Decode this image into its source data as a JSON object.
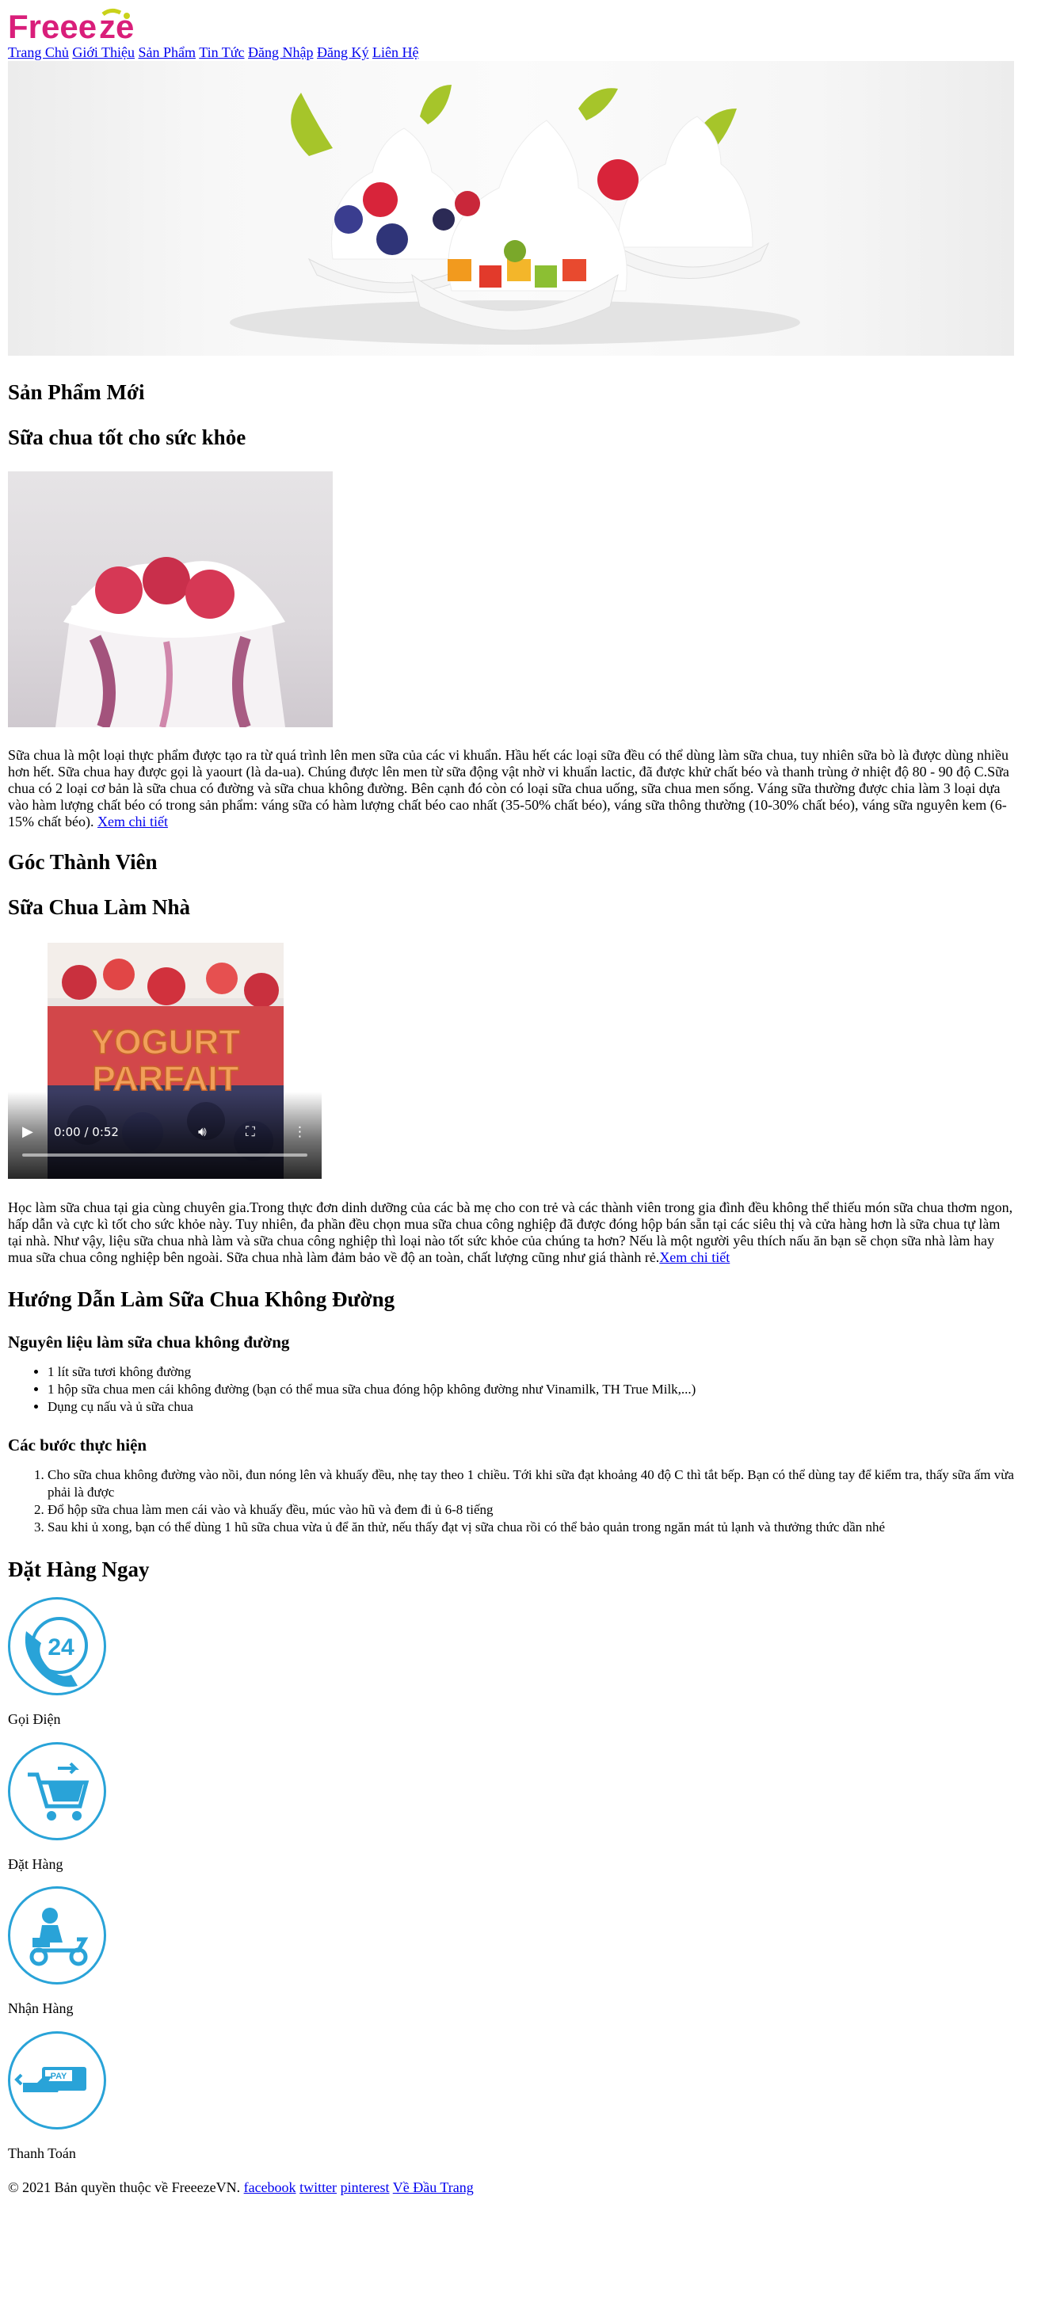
{
  "brand": {
    "logo_text": "Freeeze",
    "logo_primary_color": "#d91e7a",
    "logo_accent_color": "#c9d21a"
  },
  "nav": {
    "items": [
      {
        "label": "Trang Chủ"
      },
      {
        "label": "Giới Thiệu"
      },
      {
        "label": "Sản Phẩm"
      },
      {
        "label": "Tin Tức"
      },
      {
        "label": "Đăng Nhập"
      },
      {
        "label": "Đăng Ký"
      },
      {
        "label": "Liên Hệ"
      }
    ]
  },
  "new_products": {
    "heading": "Sản Phẩm Mới",
    "article_title": "Sữa chua tốt cho sức khỏe",
    "body": "Sữa chua là một loại thực phẩm được tạo ra từ quá trình lên men sữa của các vi khuẩn. Hầu hết các loại sữa đều có thể dùng làm sữa chua, tuy nhiên sữa bò là được dùng nhiều hơn hết. Sữa chua hay được gọi là yaourt (là da-ua). Chúng được lên men từ sữa động vật nhờ vi khuẩn lactic, đã được khử chất béo và thanh trùng ở nhiệt độ 80 - 90 độ C.Sữa chua có 2 loại cơ bản là sữa chua có đường và sữa chua không đường. Bên cạnh đó còn có loại sữa chua uống, sữa chua men sống. Váng sữa thường được chia làm 3 loại dựa vào hàm lượng chất béo có trong sản phẩm: váng sữa có hàm lượng chất béo cao nhất (35-50% chất béo), váng sữa thông thường (10-30% chất béo), váng sữa nguyên kem (6-15% chất béo). ",
    "link": "Xem chi tiết"
  },
  "members": {
    "heading": "Góc Thành Viên",
    "article_title": "Sữa Chua Làm Nhà",
    "video": {
      "overlay_line1": "YOGURT",
      "overlay_line2": "PARFAIT",
      "time": "0:00 / 0:52"
    },
    "body": "Học làm sữa chua tại gia cùng chuyên gia.Trong thực đơn dinh dưỡng của các bà mẹ cho con trẻ và các thành viên trong gia đình đều không thể thiếu món sữa chua thơm ngon, hấp dẫn và cực kì tốt cho sức khỏe này. Tuy nhiên, đa phần đều chọn mua sữa chua công nghiệp đã được đóng hộp bán sẵn tại các siêu thị và cửa hàng hơn là sữa chua tự làm tại nhà. Như vậy, liệu sữa chua nhà làm và sữa chua công nghiệp thì loại nào tốt sức khỏe của chúng ta hơn? Nếu là một người yêu thích nấu ăn bạn sẽ chọn sữa nhà làm hay mua sữa chua công nghiệp bên ngoài. Sữa chua nhà làm đảm bảo về độ an toàn, chất lượng cũng như giá thành rẻ.",
    "link": "Xem chi tiết"
  },
  "guide": {
    "heading": "Hướng Dẫn Làm Sữa Chua Không Đường",
    "ingredients_title": "Nguyên liệu làm sữa chua không đường",
    "ingredients": [
      "1 lít sữa tươi không đường",
      "1 hộp sữa chua men cái không đường (bạn có thể mua sữa chua đóng hộp không đường như Vinamilk, TH True Milk,...)",
      "Dụng cụ nấu và ủ sữa chua"
    ],
    "steps_title": "Các bước thực hiện",
    "steps": [
      "Cho sữa chua không đường vào nồi, đun nóng lên và khuấy đều, nhẹ tay theo 1 chiều. Tới khi sữa đạt khoảng 40 độ C thì tắt bếp. Bạn có thể dùng tay để kiểm tra, thấy sữa ấm vừa phải là được",
      "Đổ hộp sữa chua làm men cái vào và khuấy đều, múc vào hũ và đem đi ủ 6-8 tiếng",
      "Sau khi ủ xong, bạn có thể dùng 1 hũ sữa chua vừa ủ để ăn thử, nếu thấy đạt vị sữa chua rồi có thể bảo quản trong ngăn mát tủ lạnh và thưởng thức dần nhé"
    ]
  },
  "order": {
    "heading": "Đặt Hàng Ngay",
    "icon_color": "#29a3d8",
    "items": [
      {
        "label": "Gọi Điện",
        "icon": "phone-24-icon",
        "badge": "24"
      },
      {
        "label": "Đặt Hàng",
        "icon": "shopping-cart-icon"
      },
      {
        "label": "Nhận Hàng",
        "icon": "delivery-scooter-icon"
      },
      {
        "label": "Thanh Toán",
        "icon": "pay-card-icon",
        "badge": "PAY"
      }
    ]
  },
  "footer": {
    "copyright": "© 2021 Bản quyền thuộc về FreeezeVN. ",
    "links": [
      {
        "label": "facebook"
      },
      {
        "label": "twitter"
      },
      {
        "label": "pinterest"
      },
      {
        "label": "Về Đầu Trang"
      }
    ]
  }
}
